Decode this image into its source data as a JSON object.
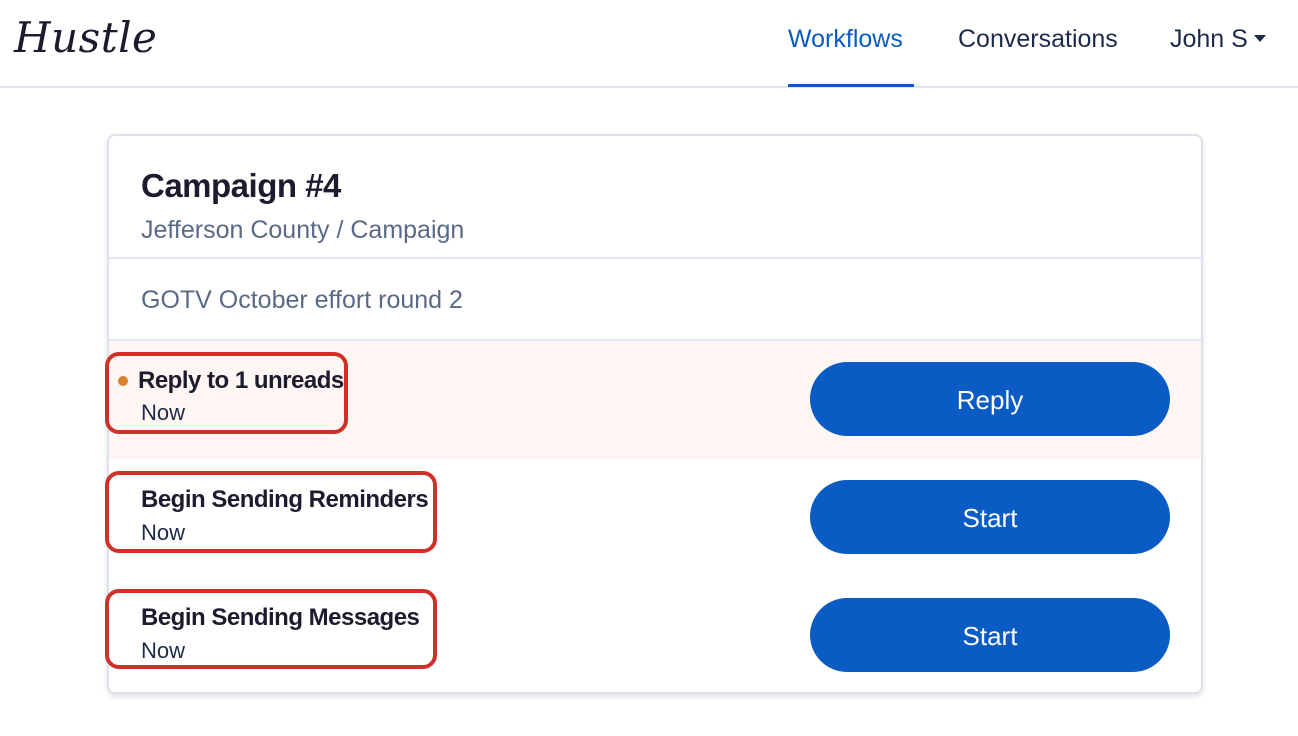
{
  "header": {
    "logo": "Hustle",
    "nav": {
      "workflows": "Workflows",
      "conversations": "Conversations",
      "user": "John S"
    }
  },
  "card": {
    "title": "Campaign #4",
    "subtitle": "Jefferson County / Campaign",
    "description": "GOTV October effort round 2",
    "tasks": [
      {
        "name": "Reply to 1 unreads",
        "time": "Now",
        "button": "Reply",
        "unread": true
      },
      {
        "name": "Begin Sending Reminders",
        "time": "Now",
        "button": "Start",
        "unread": false
      },
      {
        "name": "Begin Sending Messages",
        "time": "Now",
        "button": "Start",
        "unread": false
      }
    ]
  },
  "colors": {
    "accent": "#0b5bc4",
    "unread_dot": "#d9822b",
    "highlight_border": "#d0302a",
    "unread_row_bg": "#fdf6f3"
  }
}
